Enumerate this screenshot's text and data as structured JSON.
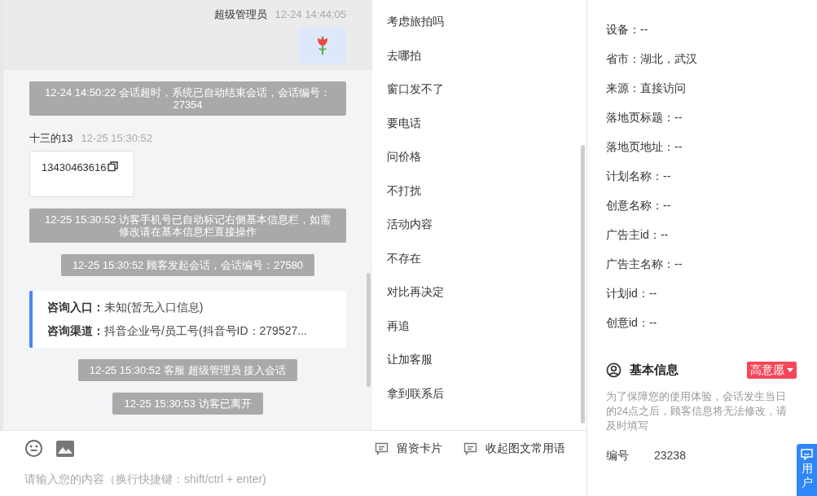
{
  "chat": {
    "messages": [
      {
        "kind": "agent",
        "sender": "超级管理员",
        "time": "12-24 14:44:05"
      },
      {
        "kind": "system",
        "text": "12-24 14:50:22 会话超时，系统已自动结束会话，会话编号：27354"
      },
      {
        "kind": "visitor",
        "sender": "十三的13",
        "time": "12-25 15:30:52",
        "text": "13430463616"
      },
      {
        "kind": "system",
        "text": "12-25 15:30:52 访客手机号已自动标记右侧基本信息栏，如需修改请在基本信息栏直接操作"
      },
      {
        "kind": "system",
        "text": "12-25 15:30:52 顾客发起会话，会话编号：27580"
      },
      {
        "kind": "info",
        "rows": [
          {
            "label": "咨询入口：",
            "value": "未知(暂无入口信息)"
          },
          {
            "label": "咨询渠道：",
            "value": "抖音企业号/员工号(抖音号ID：279527..."
          }
        ]
      },
      {
        "kind": "system",
        "text": "12-25 15:30:52 客服 超级管理员 接入会话"
      },
      {
        "kind": "system",
        "text": "12-25 15:30:53 访客已离开"
      }
    ]
  },
  "phrases": [
    "考虑旅拍吗",
    "去哪拍",
    "窗口发不了",
    "要电话",
    "问价格",
    "不打扰",
    "活动内容",
    "不存在",
    "对比再决定",
    "再追",
    "让加客服",
    "拿到联系后"
  ],
  "composer": {
    "actions": [
      "留资卡片",
      "收起图文常用语"
    ],
    "placeholder": "请输入您的内容（换行快捷键：shift/ctrl + enter)"
  },
  "source_info": {
    "fields": [
      "设备：--",
      "省市：湖北，武汉",
      "来源：直接访问",
      "落地页标题：--",
      "落地页地址：--",
      "计划名称：--",
      "创意名称：--",
      "广告主id：--",
      "广告主名称：--",
      "计划id：--",
      "创意id：--"
    ]
  },
  "basic_info": {
    "title": "基本信息",
    "intent_tag": "高意愿",
    "notice": "为了保障您的使用体验，会话发生当日的24点之后，顾客信息将无法修改，请及时填写",
    "fields": [
      {
        "label": "编号",
        "value": "23238"
      }
    ]
  },
  "float_button": {
    "label": "用户"
  }
}
